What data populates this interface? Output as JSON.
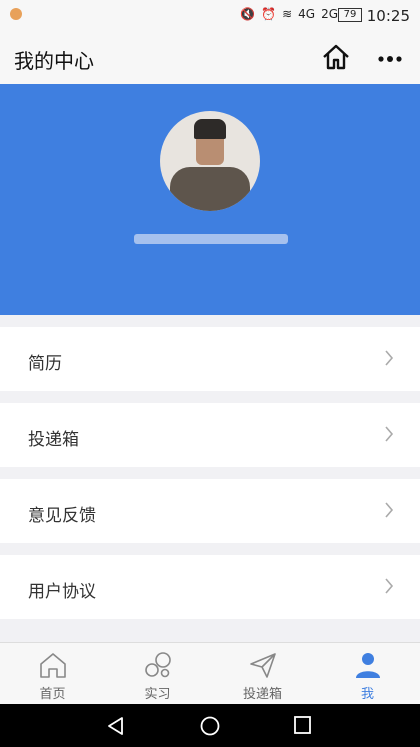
{
  "status": {
    "battery": "79",
    "time": "10:25",
    "signal_a": "4G",
    "signal_b": "2G"
  },
  "header": {
    "title": "我的中心"
  },
  "menu": [
    {
      "label": "简历"
    },
    {
      "label": "投递箱"
    },
    {
      "label": "意见反馈"
    },
    {
      "label": "用户协议"
    }
  ],
  "tabs": [
    {
      "label": "首页",
      "icon": "home-outline-icon"
    },
    {
      "label": "实习",
      "icon": "bubbles-icon"
    },
    {
      "label": "投递箱",
      "icon": "paper-plane-icon"
    },
    {
      "label": "我",
      "icon": "person-icon"
    }
  ],
  "colors": {
    "accent": "#3f7fe0",
    "background": "#f1f1f4"
  }
}
